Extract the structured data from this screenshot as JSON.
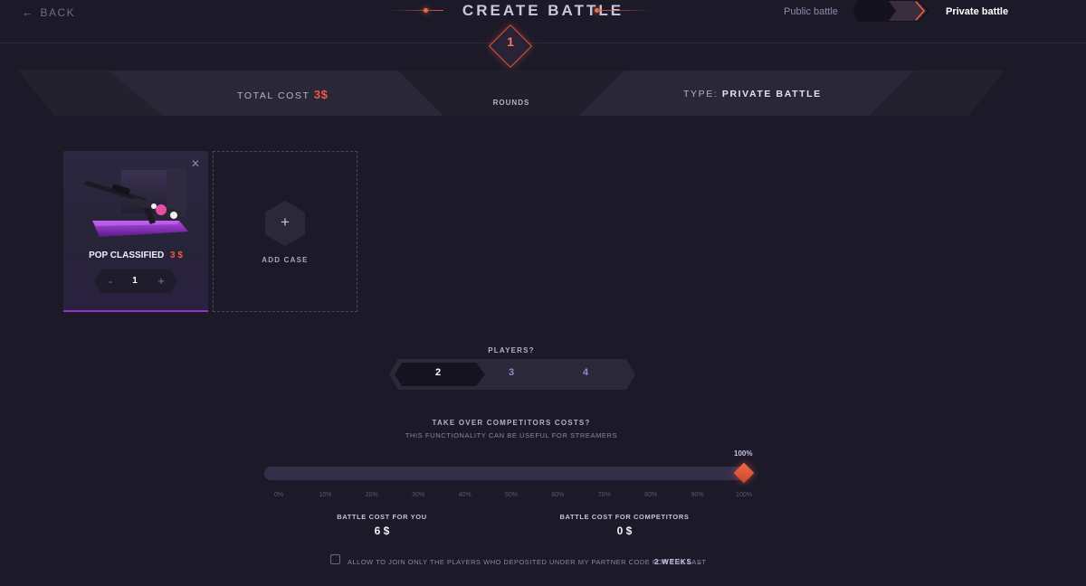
{
  "header": {
    "back_label": "BACK",
    "title": "CREATE BATTLE",
    "mode_public": "Public battle",
    "mode_private": "Private battle",
    "selected_mode": "private"
  },
  "summary": {
    "round_number": "1",
    "total_cost_label": "TOTAL COST",
    "total_cost_value": "3$",
    "rounds_label": "ROUNDS",
    "type_label": "TYPE:",
    "type_value": "PRIVATE BATTLE"
  },
  "cases": [
    {
      "name": "POP CLASSIFIED",
      "price": "3 $",
      "quantity": "1"
    }
  ],
  "add_case": {
    "label": "ADD CASE"
  },
  "stepper": {
    "minus": "-",
    "plus": "+"
  },
  "players": {
    "label": "PLAYERS?",
    "options": [
      "2",
      "3",
      "4"
    ],
    "selected": "2"
  },
  "takeover": {
    "title": "TAKE OVER COMPETITORS COSTS?",
    "subtitle": "THIS FUNCTIONALITY CAN BE USEFUL FOR STREAMERS",
    "value_label": "100%",
    "value_fraction": 1.0,
    "ticks": [
      "0%",
      "10%",
      "20%",
      "30%",
      "40%",
      "50%",
      "60%",
      "70%",
      "80%",
      "90%",
      "100%"
    ]
  },
  "costs": {
    "you_label": "BATTLE COST FOR YOU",
    "you_value": "6 $",
    "competitors_label": "BATTLE COST FOR COMPETITORS",
    "competitors_value": "0 $"
  },
  "partner": {
    "checked": false,
    "text": "ALLOW TO JOIN ONLY THE PLAYERS WHO DEPOSITED UNDER MY PARTNER CODE FOR THE LAST",
    "period": "2 WEEKS"
  },
  "colors": {
    "background": "#1c1a29",
    "accent": "#f0593c",
    "case_glow": "#8f36c4"
  },
  "icons": {
    "back": "arrow-left-icon",
    "close": "close-icon",
    "add": "plus-icon",
    "dropdown": "chevron-down-icon"
  }
}
